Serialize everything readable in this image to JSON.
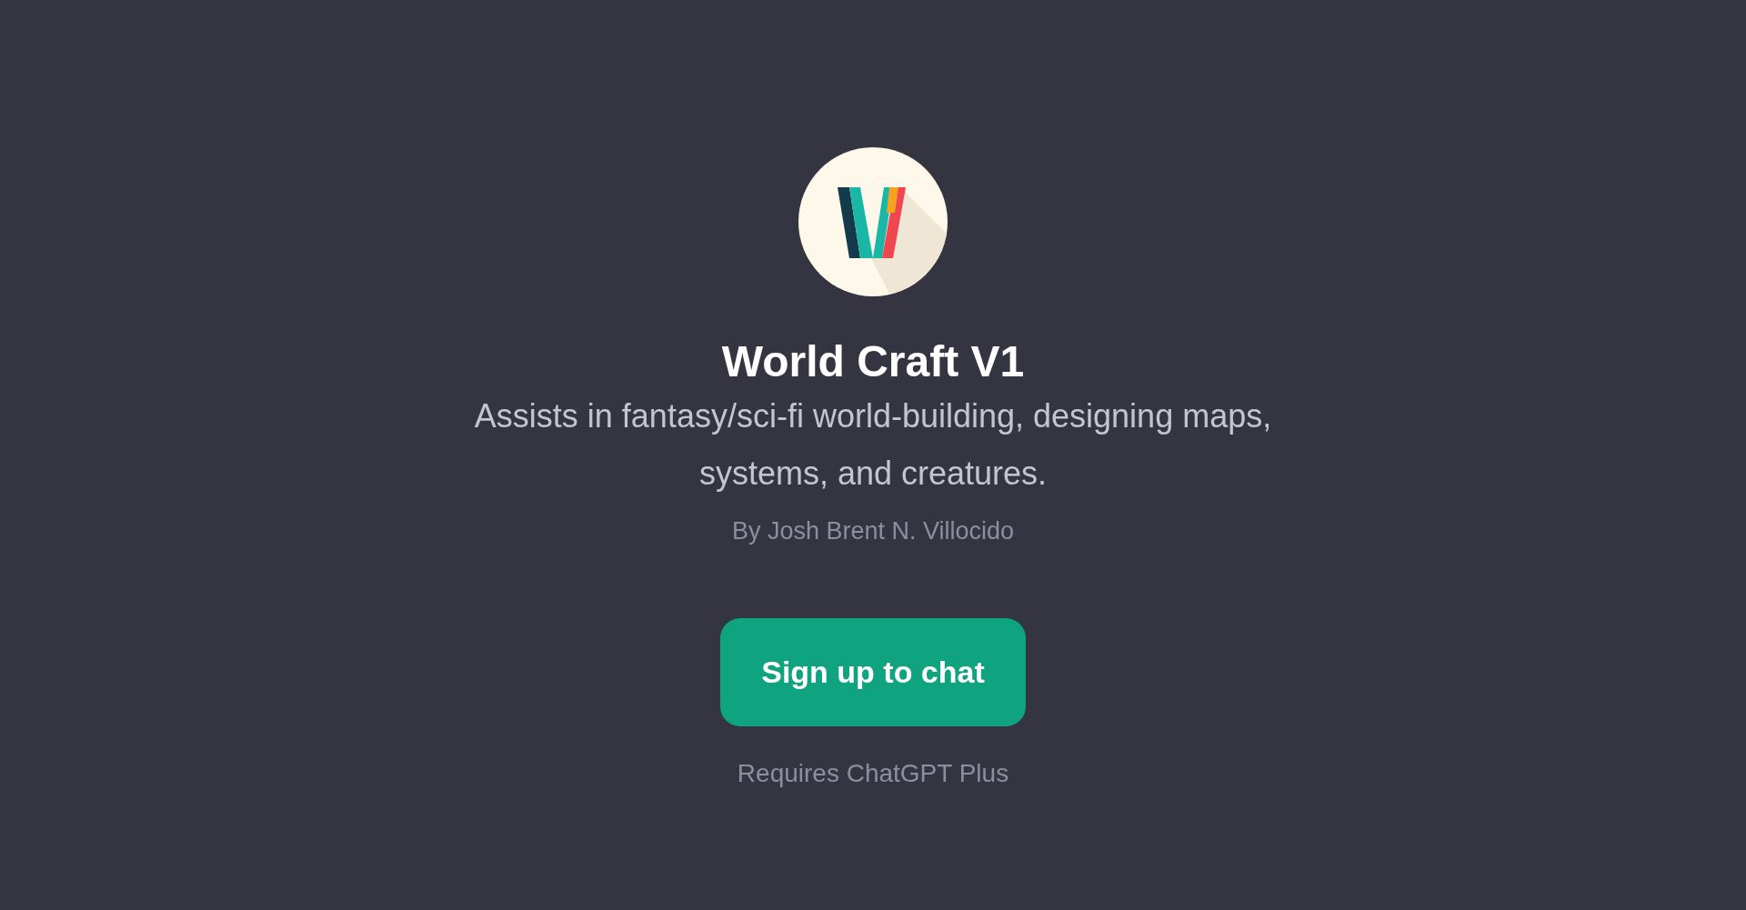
{
  "title": "World Craft V1",
  "description": "Assists in fantasy/sci-fi world-building, designing maps, systems, and creatures.",
  "author": "By Josh Brent N. Villocido",
  "button": "Sign up to chat",
  "note": "Requires ChatGPT Plus"
}
